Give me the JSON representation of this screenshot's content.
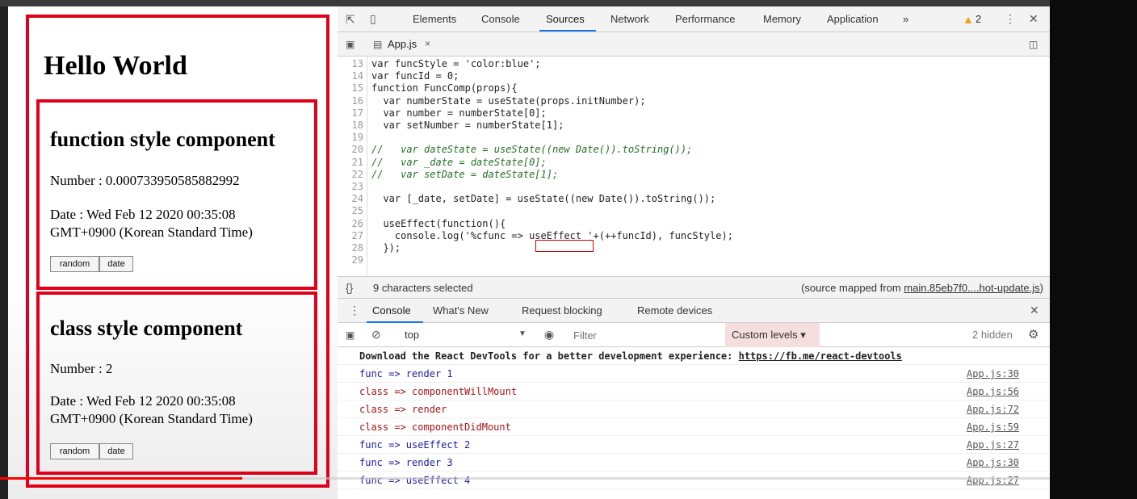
{
  "page": {
    "title": "Hello World",
    "func_component": {
      "heading": "function style component",
      "number_line": "Number : 0.000733950585882992",
      "date_line1": "Date : Wed Feb 12 2020 00:35:08",
      "date_line2": "GMT+0900 (Korean Standard Time)",
      "btn_random": "random",
      "btn_date": "date"
    },
    "class_component": {
      "heading": "class style component",
      "number_line": "Number : 2",
      "date_line1": "Date : Wed Feb 12 2020 00:35:08",
      "date_line2": "GMT+0900 (Korean Standard Time)",
      "btn_random": "random",
      "btn_date": "date"
    },
    "accent_color": "#e0001b"
  },
  "devtools": {
    "tabs": [
      "Elements",
      "Console",
      "Sources",
      "Network",
      "Performance",
      "Memory",
      "Application"
    ],
    "active_tab": "Sources",
    "more_tabs": "»",
    "warning_count": "2",
    "file_tab": "App.js",
    "code_lines": [
      {
        "n": "13",
        "text": "var funcStyle = 'color:blue';"
      },
      {
        "n": "14",
        "text": "var funcId = 0;"
      },
      {
        "n": "15",
        "text": "function FuncComp(props){"
      },
      {
        "n": "16",
        "text": "  var numberState = useState(props.initNumber);"
      },
      {
        "n": "17",
        "text": "  var number = numberState[0];"
      },
      {
        "n": "18",
        "text": "  var setNumber = numberState[1];"
      },
      {
        "n": "19",
        "text": ""
      },
      {
        "n": "20",
        "text": "//   var dateState = useState((new Date()).toString());"
      },
      {
        "n": "21",
        "text": "//   var _date = dateState[0];"
      },
      {
        "n": "22",
        "text": "//   var setDate = dateState[1];"
      },
      {
        "n": "23",
        "text": ""
      },
      {
        "n": "24",
        "text": "  var [_date, setDate] = useState((new Date()).toString());"
      },
      {
        "n": "25",
        "text": ""
      },
      {
        "n": "26",
        "text": "  useEffect(function(){"
      },
      {
        "n": "27",
        "text": "    console.log('%cfunc => useEffect '+(++funcId), funcStyle);"
      },
      {
        "n": "28",
        "text": "  });"
      },
      {
        "n": "29",
        "text": ""
      }
    ],
    "status_left": "9 characters selected",
    "status_right_prefix": "(source mapped from ",
    "status_right_link": "main.85eb7f0....hot-update.js",
    "status_right_suffix": ")",
    "drawer_tabs": [
      "Console",
      "What's New",
      "Request blocking",
      "Remote devices"
    ],
    "console_context": "top",
    "filter_placeholder": "Filter",
    "levels": "Custom levels ▾",
    "hidden": "2 hidden",
    "console_rows": [
      {
        "msg": "Download the React DevTools for a better development experience: ",
        "link": "https://fb.me/react-devtools",
        "src": "",
        "color": "#222"
      },
      {
        "msg": "func => render 1",
        "link": "",
        "src": "App.js:30",
        "color": "#1a1aa6"
      },
      {
        "msg": "class => componentWillMount",
        "link": "",
        "src": "App.js:56",
        "color": "#a31515"
      },
      {
        "msg": "class => render",
        "link": "",
        "src": "App.js:72",
        "color": "#a31515"
      },
      {
        "msg": "class => componentDidMount",
        "link": "",
        "src": "App.js:59",
        "color": "#a31515"
      },
      {
        "msg": "func => useEffect 2",
        "link": "",
        "src": "App.js:27",
        "color": "#1a1aa6"
      },
      {
        "msg": "func => render 3",
        "link": "",
        "src": "App.js:30",
        "color": "#1a1aa6"
      },
      {
        "msg": "func => useEffect 4",
        "link": "",
        "src": "App.js:27",
        "color": "#1a1aa6"
      }
    ]
  }
}
